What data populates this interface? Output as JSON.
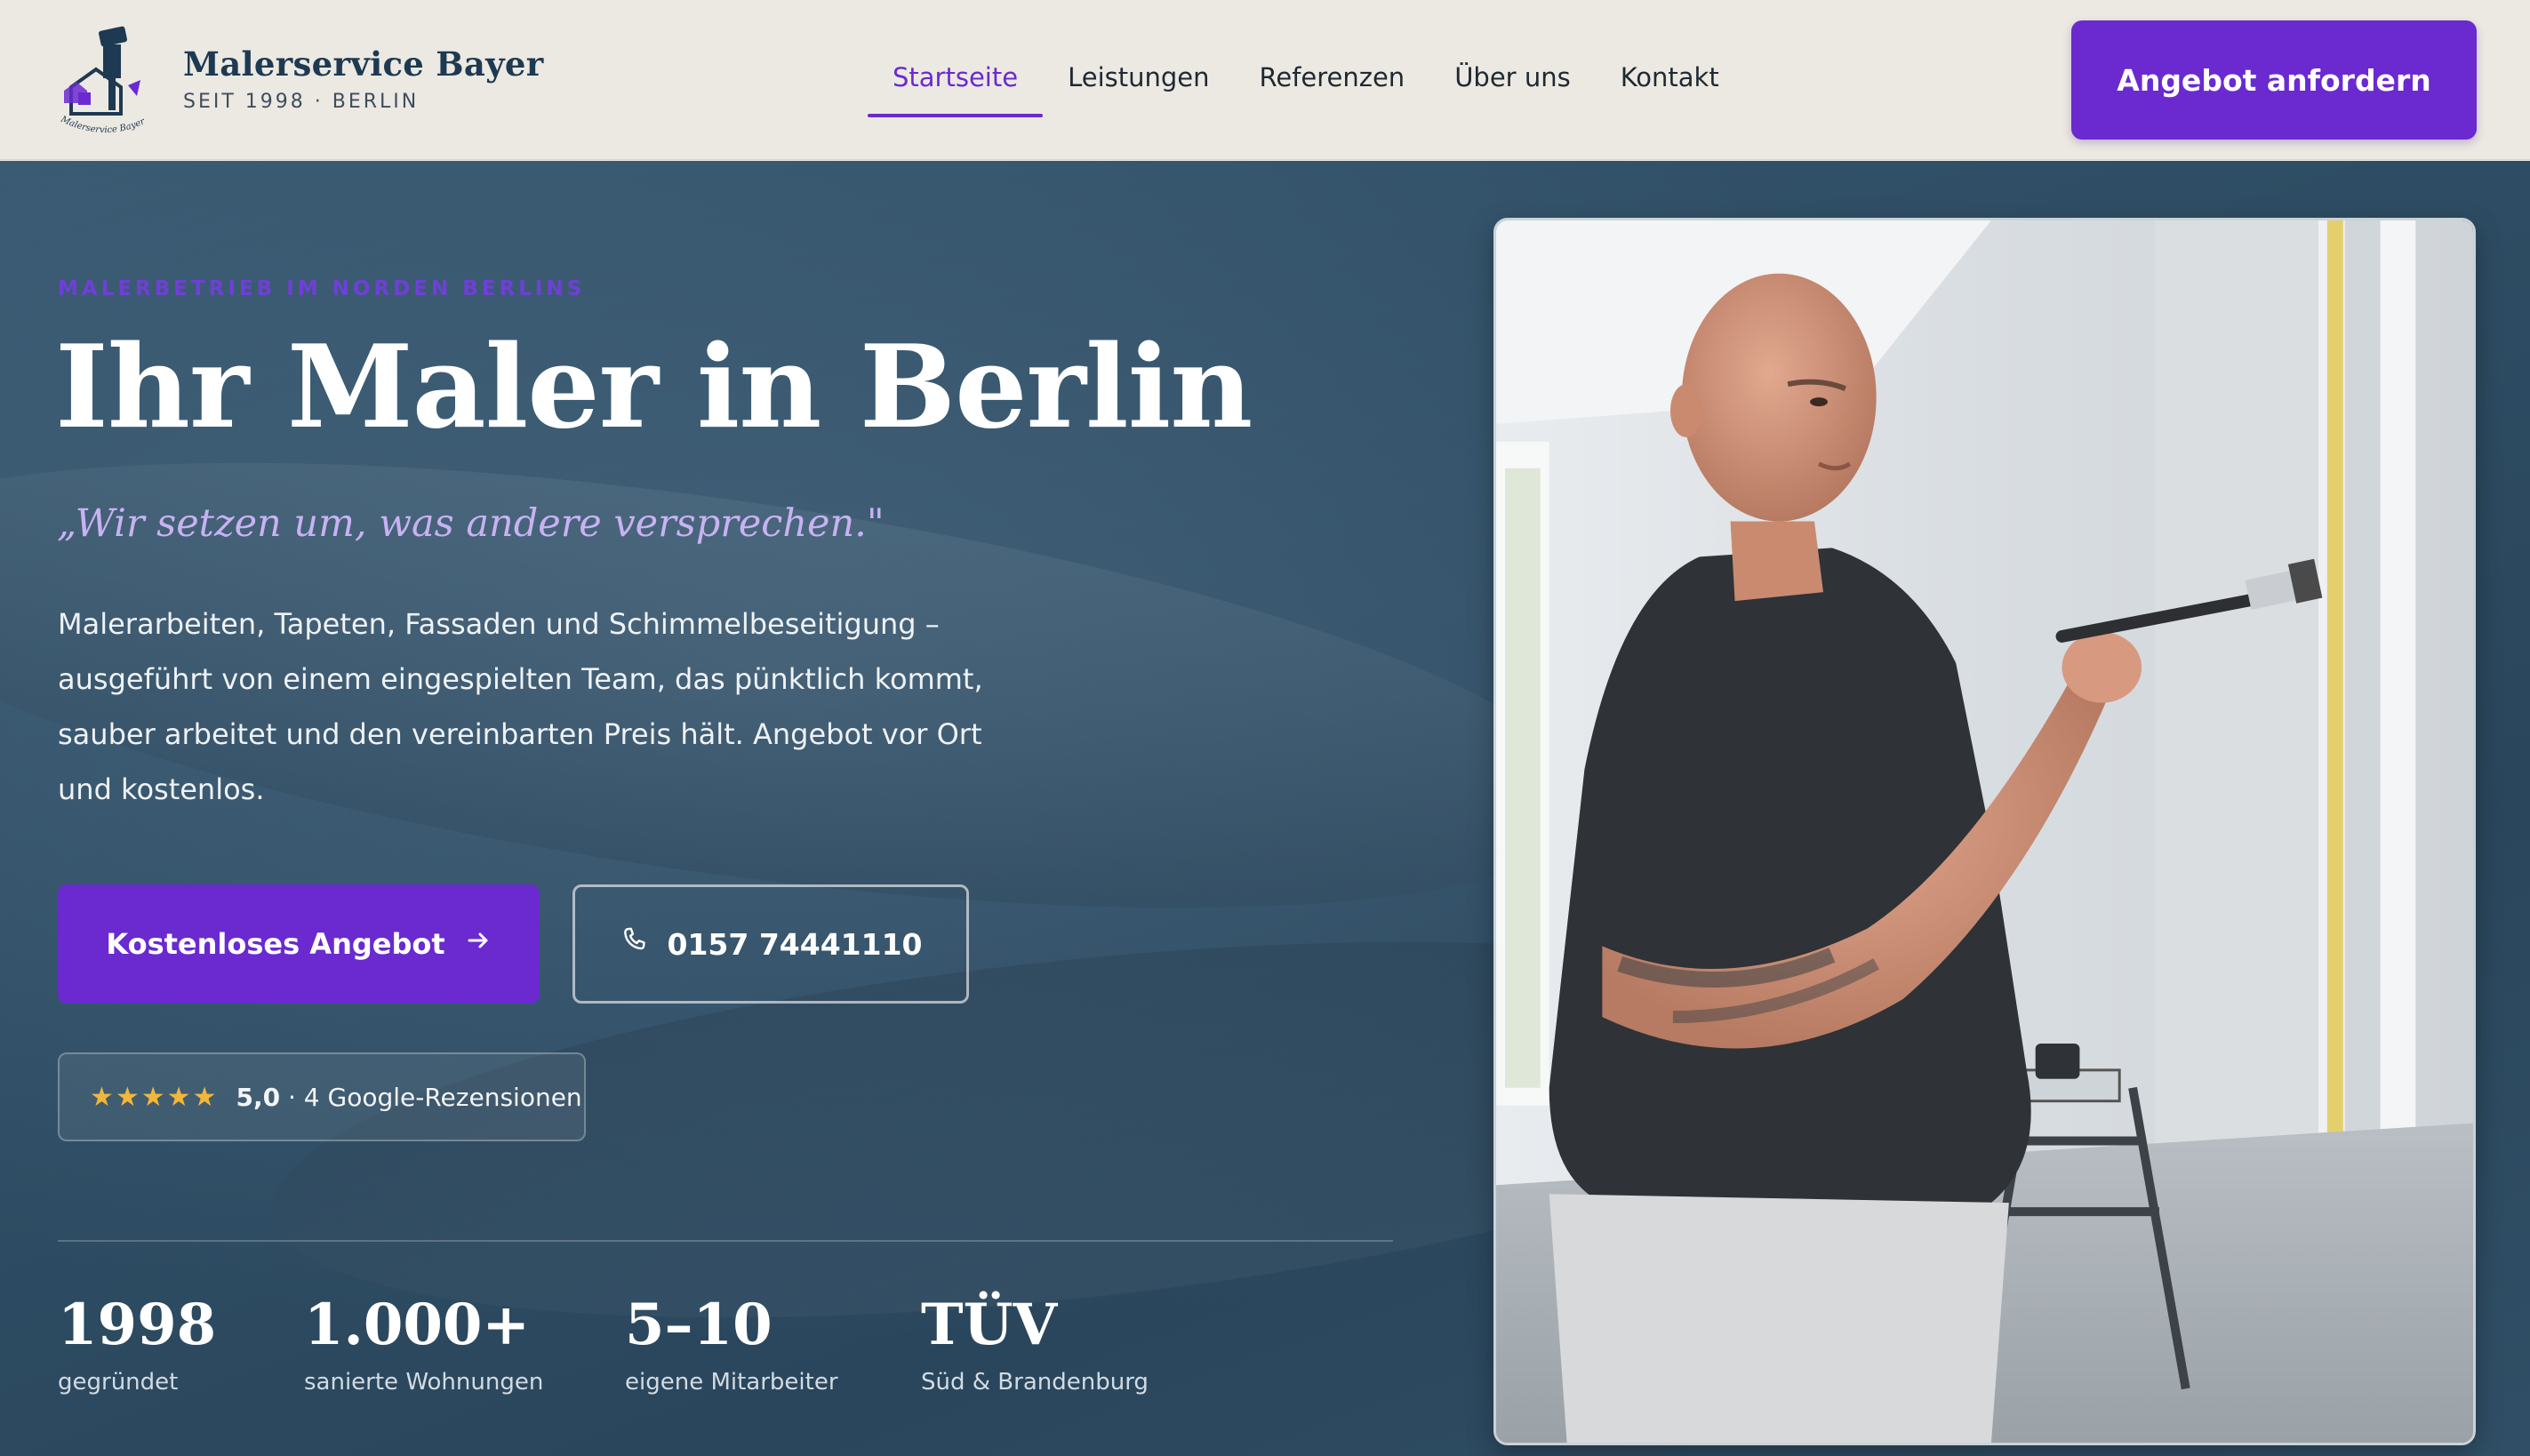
{
  "brand": {
    "name": "Malerservice Bayer",
    "tagline": "SEIT 1998 · BERLIN",
    "logo_text": "Malerservice Bayer"
  },
  "nav": {
    "items": [
      {
        "label": "Startseite",
        "active": true
      },
      {
        "label": "Leistungen",
        "active": false
      },
      {
        "label": "Referenzen",
        "active": false
      },
      {
        "label": "Über uns",
        "active": false
      },
      {
        "label": "Kontakt",
        "active": false
      }
    ],
    "cta_label": "Angebot anfordern"
  },
  "hero": {
    "eyebrow": "MALERBETRIEB IM NORDEN BERLINS",
    "title": "Ihr Maler in Berlin",
    "quote": "„Wir setzen um, was andere versprechen.\"",
    "lead": "Malerarbeiten, Tapeten, Fassaden und Schimmelbeseitigung – ausgeführt von einem eingespielten Team, das pünktlich kommt, sauber arbeitet und den vereinbarten Preis hält. Angebot vor Ort und kostenlos.",
    "primary_button": "Kostenloses Angebot",
    "primary_icon": "arrow-right-icon",
    "phone_button": "0157 74441110",
    "phone_icon": "phone-icon",
    "rating": {
      "stars": "★★★★★",
      "score": "5,0",
      "text": "· 4 Google-Rezensionen"
    }
  },
  "stats": [
    {
      "value": "1998",
      "label": "gegründet"
    },
    {
      "value": "1.000+",
      "label": "sanierte Wohnungen"
    },
    {
      "value": "5–10",
      "label": "eigene Mitarbeiter"
    },
    {
      "value": "TÜV",
      "label": "Süd & Brandenburg"
    }
  ],
  "colors": {
    "accent": "#6a2ad0",
    "hero_bg": "#2e4d64",
    "header_bg": "#ece9e2",
    "star": "#f2b63a"
  }
}
